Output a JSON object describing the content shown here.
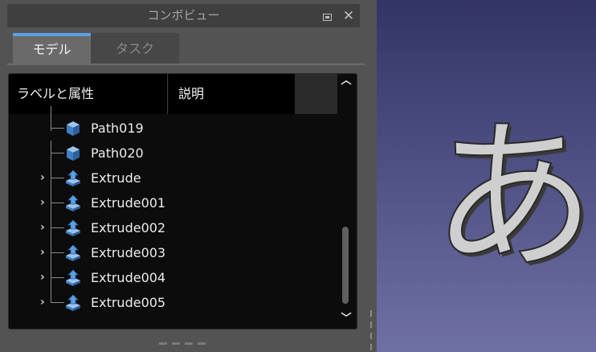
{
  "panel": {
    "title": "コンボビュー",
    "tabs": [
      {
        "label": "モデル",
        "active": true
      },
      {
        "label": "タスク",
        "active": false
      }
    ]
  },
  "tree": {
    "columns": [
      "ラベルと属性",
      "説明"
    ],
    "items": [
      {
        "label": "Path019",
        "type": "path",
        "expandable": false
      },
      {
        "label": "Path020",
        "type": "path",
        "expandable": false
      },
      {
        "label": "Extrude",
        "type": "extrude",
        "expandable": true
      },
      {
        "label": "Extrude001",
        "type": "extrude",
        "expandable": true
      },
      {
        "label": "Extrude002",
        "type": "extrude",
        "expandable": true
      },
      {
        "label": "Extrude003",
        "type": "extrude",
        "expandable": true
      },
      {
        "label": "Extrude004",
        "type": "extrude",
        "expandable": true
      },
      {
        "label": "Extrude005",
        "type": "extrude",
        "expandable": true
      }
    ]
  },
  "view3d": {
    "model_text": "あ"
  },
  "colors": {
    "accent": "#5b9fe4",
    "tree_background": "#0c0c0c",
    "panel_background": "#535353",
    "view_top": "#333466",
    "view_bottom": "#6f70a5"
  }
}
